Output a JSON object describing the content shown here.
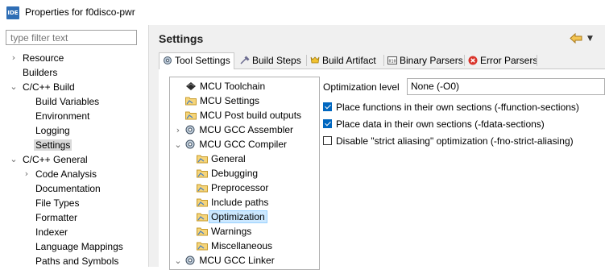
{
  "window": {
    "app_icon_text": "IDE",
    "title": "Properties for f0disco-pwr"
  },
  "filter": {
    "placeholder": "type filter text"
  },
  "nav": [
    {
      "label": "Resource",
      "expanded": false
    },
    {
      "label": "Builders"
    },
    {
      "label": "C/C++ Build",
      "expanded": true
    },
    {
      "label": "Build Variables"
    },
    {
      "label": "Environment"
    },
    {
      "label": "Logging"
    },
    {
      "label": "Settings",
      "selected": true
    },
    {
      "label": "C/C++ General",
      "expanded": true
    },
    {
      "label": "Code Analysis",
      "expanded": false
    },
    {
      "label": "Documentation"
    },
    {
      "label": "File Types"
    },
    {
      "label": "Formatter"
    },
    {
      "label": "Indexer"
    },
    {
      "label": "Language Mappings"
    },
    {
      "label": "Paths and Symbols"
    }
  ],
  "header": {
    "title": "Settings",
    "back_icon": "back-arrow-icon",
    "menu_icon": "view-menu-icon"
  },
  "tabs": [
    {
      "label": "Tool Settings",
      "icon": "tool-settings-icon",
      "active": true
    },
    {
      "label": "Build Steps",
      "icon": "build-steps-icon"
    },
    {
      "label": "Build Artifact",
      "icon": "build-artifact-icon"
    },
    {
      "label": "Binary Parsers",
      "icon": "binary-parsers-icon"
    },
    {
      "label": "Error Parsers",
      "icon": "error-parsers-icon"
    }
  ],
  "tool_tree": [
    {
      "label": "MCU Toolchain",
      "icon": "chip-icon"
    },
    {
      "label": "MCU Settings",
      "icon": "folder-settings-icon"
    },
    {
      "label": "MCU Post build outputs",
      "icon": "folder-settings-icon"
    },
    {
      "label": "MCU GCC Assembler",
      "icon": "gear-icon",
      "expanded": false
    },
    {
      "label": "MCU GCC Compiler",
      "icon": "gear-icon",
      "expanded": true
    },
    {
      "label": "General",
      "icon": "folder-settings-icon"
    },
    {
      "label": "Debugging",
      "icon": "folder-settings-icon"
    },
    {
      "label": "Preprocessor",
      "icon": "folder-settings-icon"
    },
    {
      "label": "Include paths",
      "icon": "folder-settings-icon"
    },
    {
      "label": "Optimization",
      "icon": "folder-settings-icon",
      "selected": true
    },
    {
      "label": "Warnings",
      "icon": "folder-settings-icon"
    },
    {
      "label": "Miscellaneous",
      "icon": "folder-settings-icon"
    },
    {
      "label": "MCU GCC Linker",
      "icon": "gear-icon",
      "expanded": true
    }
  ],
  "optimization": {
    "level_label": "Optimization level",
    "level_value": "None (-O0)",
    "options": [
      {
        "label": "Place functions in their own sections (-ffunction-sections)",
        "checked": true
      },
      {
        "label": "Place data in their own sections (-fdata-sections)",
        "checked": true
      },
      {
        "label": "Disable \"strict aliasing\" optimization (-fno-strict-aliasing)",
        "checked": false
      }
    ]
  }
}
